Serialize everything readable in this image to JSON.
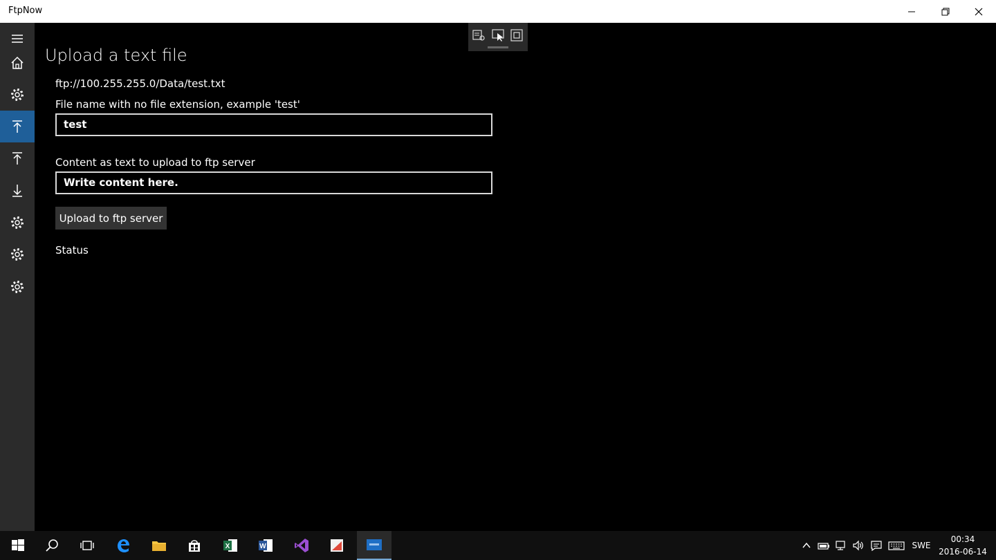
{
  "window": {
    "title": "FtpNow",
    "minimize_icon": "minimize-icon",
    "maximize_icon": "restore-icon",
    "close_icon": "close-icon"
  },
  "nav": {
    "items": [
      {
        "icon": "hamburger-menu-icon"
      },
      {
        "icon": "home-icon"
      },
      {
        "icon": "gear-icon"
      },
      {
        "icon": "upload-icon",
        "selected": true
      },
      {
        "icon": "upload-icon"
      },
      {
        "icon": "download-icon"
      },
      {
        "icon": "gear-icon"
      },
      {
        "icon": "gear-icon"
      },
      {
        "icon": "gear-icon"
      }
    ],
    "selected_color": "#1f5f99"
  },
  "page": {
    "title": "Upload a text file",
    "ftp_path": "ftp://100.255.255.0/Data/test.txt",
    "filename_label": "File name with no file extension, example 'test'",
    "filename_value": "test",
    "content_label": "Content as text to upload to ftp server",
    "content_value": "Write content here.",
    "upload_button": "Upload to ftp server",
    "status_label": "Status"
  },
  "taskbar": {
    "apps": [
      "start-icon",
      "search-icon",
      "task-view-icon",
      "edge-icon",
      "file-explorer-icon",
      "store-icon",
      "excel-icon",
      "word-icon",
      "visual-studio-icon",
      "pdf-icon",
      "ftpnow-app-icon"
    ],
    "language": "SWE",
    "time": "00:34",
    "date": "2016-06-14"
  }
}
